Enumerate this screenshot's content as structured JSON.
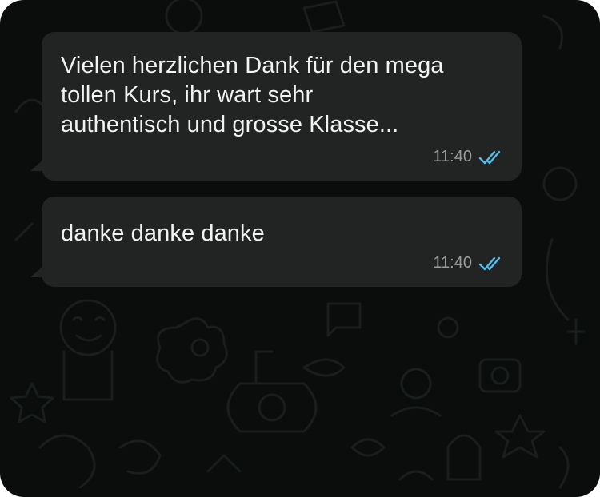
{
  "messages": [
    {
      "text": "Vielen herzlichen Dank für den mega\ntollen Kurs, ihr wart sehr\nauthentisch und grosse Klasse...",
      "time": "11:40",
      "status": "read",
      "status_icon": "double-check-icon",
      "status_color": "#53bdeb"
    },
    {
      "text": "danke danke danke",
      "time": "11:40",
      "status": "read",
      "status_icon": "double-check-icon",
      "status_color": "#53bdeb"
    }
  ],
  "colors": {
    "background": "#0b0d0d",
    "bubble": "#222424",
    "text": "#f2f2f2",
    "meta": "#9a9c9c"
  }
}
